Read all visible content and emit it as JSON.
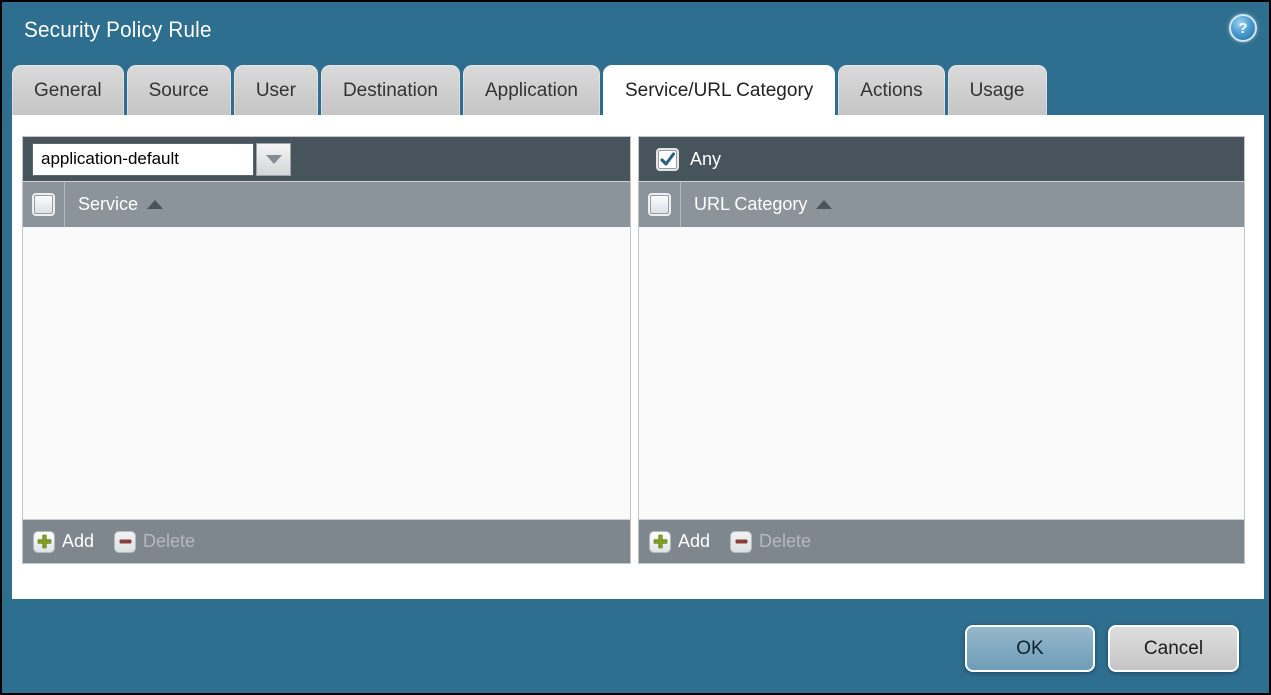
{
  "window": {
    "title": "Security Policy Rule",
    "help_glyph": "?"
  },
  "tabs": [
    {
      "label": "General",
      "active": false
    },
    {
      "label": "Source",
      "active": false
    },
    {
      "label": "User",
      "active": false
    },
    {
      "label": "Destination",
      "active": false
    },
    {
      "label": "Application",
      "active": false
    },
    {
      "label": "Service/URL Category",
      "active": true
    },
    {
      "label": "Actions",
      "active": false
    },
    {
      "label": "Usage",
      "active": false
    }
  ],
  "service_panel": {
    "dropdown_value": "application-default",
    "column_header": "Service",
    "header_checkbox_checked": false,
    "rows": [],
    "add_label": "Add",
    "delete_label": "Delete",
    "delete_enabled": false
  },
  "url_category_panel": {
    "any_label": "Any",
    "any_checked": true,
    "column_header": "URL Category",
    "header_checkbox_checked": false,
    "rows": [],
    "add_label": "Add",
    "delete_label": "Delete",
    "delete_enabled": false
  },
  "dialog_buttons": {
    "ok_label": "OK",
    "cancel_label": "Cancel"
  },
  "colors": {
    "window_background": "#2e6e8e",
    "dark_header": "#48545c",
    "column_header": "#8c949b",
    "panel_footer": "#7e878e",
    "tab_inactive": "#cccccc",
    "tab_active": "#ffffff",
    "add_icon_green": "#7f9e1f",
    "delete_icon_red": "#8a3d3d",
    "sort_arrow": "#49545b",
    "ok_button": "#7ba6bf",
    "cancel_button": "#d2d2d2",
    "help_icon_blue": "#2a7ab0",
    "check_mark": "#2d5f80"
  }
}
